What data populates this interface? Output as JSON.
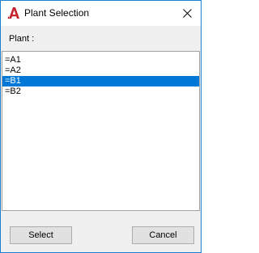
{
  "window": {
    "title": "Plant Selection",
    "icon": "autocad-logo-icon",
    "close_icon": "close-icon"
  },
  "form": {
    "plant_label": "Plant :"
  },
  "plants": {
    "items": [
      "=A1",
      "=A2",
      "=B1",
      "=B2"
    ],
    "selected": "=B1"
  },
  "buttons": {
    "select_label": "Select",
    "cancel_label": "Cancel"
  },
  "colors": {
    "accent": "#1b7fd1",
    "selection": "#0078d7",
    "logo_red": "#c4262e"
  }
}
